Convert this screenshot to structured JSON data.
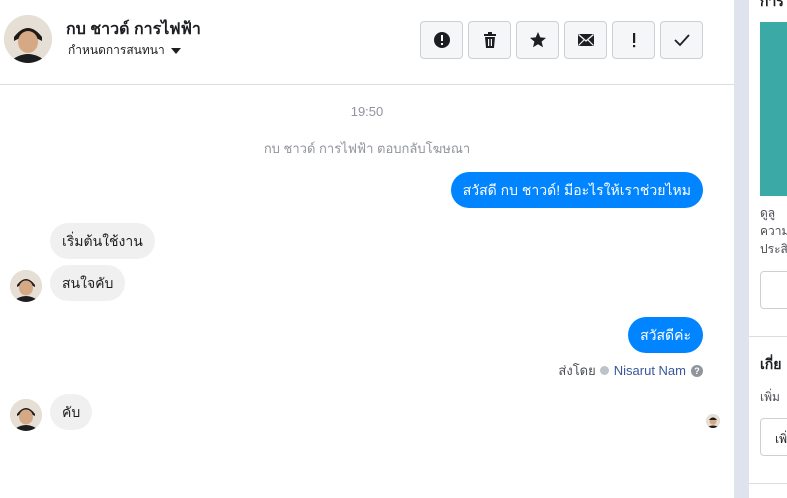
{
  "header": {
    "title": "กบ ชาวด์ การไฟฟ้า",
    "subtitle": "กำหนดการสนทนา"
  },
  "toolbar": [
    {
      "name": "report-button",
      "icon": "alert-circle-icon"
    },
    {
      "name": "delete-button",
      "icon": "trash-icon"
    },
    {
      "name": "star-button",
      "icon": "star-icon"
    },
    {
      "name": "mark-unread-button",
      "icon": "envelope-icon"
    },
    {
      "name": "important-button",
      "icon": "exclamation-icon"
    },
    {
      "name": "done-button",
      "icon": "checkmark-icon"
    }
  ],
  "conversation": {
    "time": "19:50",
    "note": "กบ ชาวด์ การไฟฟ้า ตอบกลับโฆษณา",
    "messages": [
      {
        "direction": "out",
        "text": "สวัสดี กบ ชาวด์! มีอะไรให้เราช่วยไหม"
      },
      {
        "direction": "in",
        "text": "เริ่มต้นใช้งาน"
      },
      {
        "direction": "in",
        "text": "สนใจคับ"
      },
      {
        "direction": "out",
        "text": "สวัสดีค่ะ"
      },
      {
        "direction": "in",
        "text": "คับ"
      }
    ],
    "sent_by_label": "ส่งโดย",
    "sent_by_name": "Nisarut Nam"
  },
  "right_panel": {
    "cut_title": "การ",
    "desc_lines": [
      "ดูลู",
      "ความ",
      "ประสิ"
    ],
    "section_title": "เกี่ย",
    "section_sub": "เพิ่ม",
    "button_label": "เพิ่"
  },
  "colors": {
    "accent": "#0084ff",
    "incoming_bubble": "#f1f0f0",
    "teal_card": "#3ba9a6"
  }
}
